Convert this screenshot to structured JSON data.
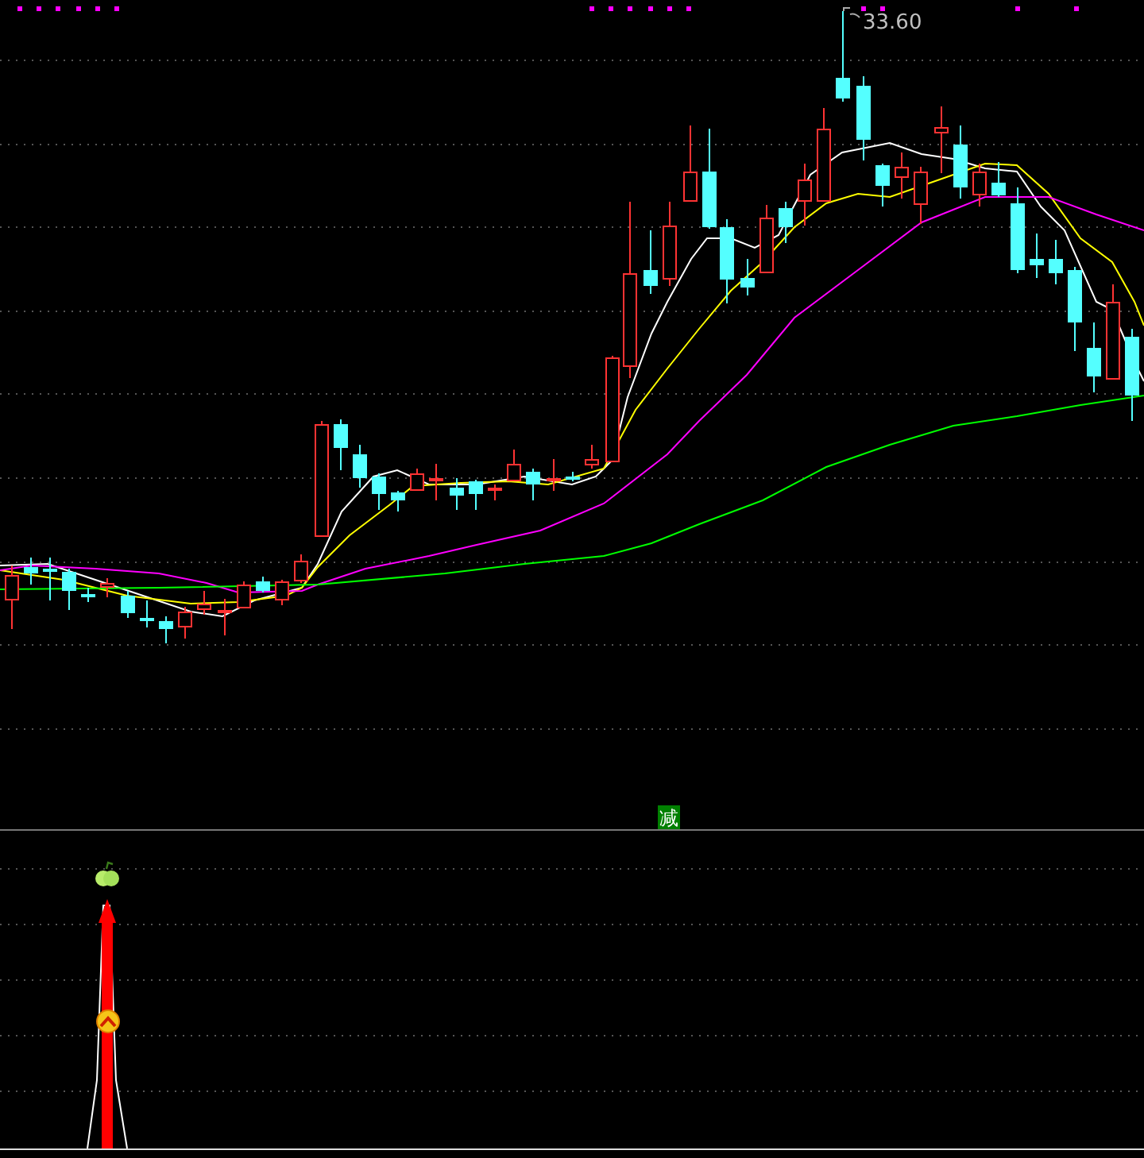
{
  "price_chart": {
    "high_price_label": "33.60",
    "signal_label": "减"
  }
}
